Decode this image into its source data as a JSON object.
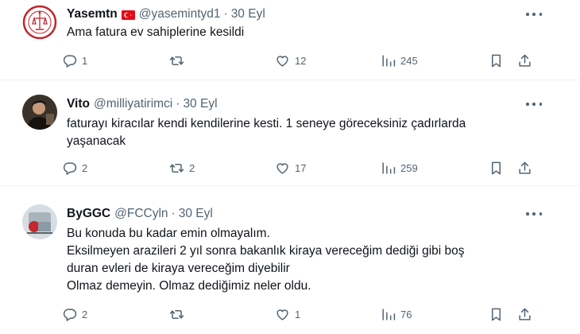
{
  "tweets": [
    {
      "name": "Yasemtn",
      "handle": "@yasemintyd1",
      "separator": "·",
      "time": "30 Eyl",
      "text": "Ama fatura ev sahiplerine kesildi",
      "replies": "1",
      "retweets": "",
      "likes": "12",
      "views": "245",
      "has_flag": true
    },
    {
      "name": "Vito",
      "handle": "@milliyatirimci",
      "separator": "·",
      "time": "30 Eyl",
      "text": "faturayı kiracılar kendi kendilerine kesti. 1 seneye göreceksiniz çadırlarda\nyaşanacak",
      "replies": "2",
      "retweets": "2",
      "likes": "17",
      "views": "259"
    },
    {
      "name": "ByGGC",
      "handle": "@FCCyln",
      "separator": "·",
      "time": "30 Eyl",
      "text": "Bu konuda bu kadar emin olmayalım.\nEksilmeyen arazileri 2 yıl sonra bakanlık kiraya vereceğim dediği gibi boş\nduran evleri de kiraya vereceğim diyebilir\nOlmaz demeyin. Olmaz dediğimiz neler oldu.",
      "replies": "2",
      "retweets": "",
      "likes": "1",
      "views": "76"
    }
  ],
  "icons": {
    "reply": "reply-icon",
    "retweet": "retweet-icon",
    "like": "heart-icon",
    "views": "views-chart-icon",
    "bookmark": "bookmark-icon",
    "share": "share-icon",
    "more": "more-dots-icon",
    "flag": "turkey-flag-icon"
  },
  "colors": {
    "text": "#0f1419",
    "secondary": "#536471",
    "divider": "#eff3f4",
    "flag_red": "#e30a17"
  }
}
